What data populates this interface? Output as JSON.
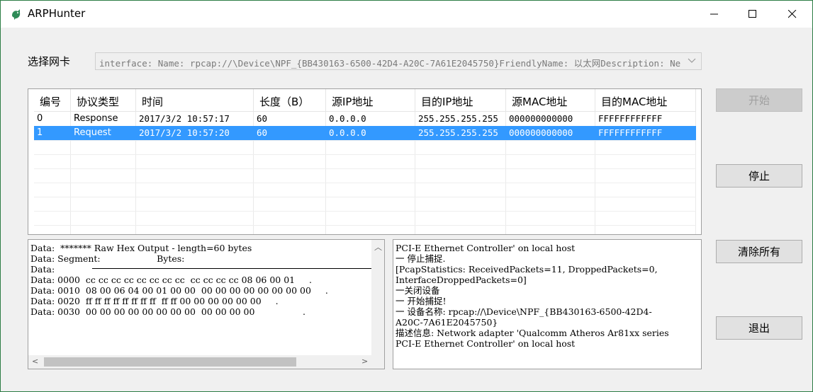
{
  "window": {
    "title": "ARPHunter"
  },
  "nic": {
    "label": "选择网卡",
    "value": "interface: Name: rpcap://\\Device\\NPF_{BB430163-6500-42D4-A20C-7A61E2045750}FriendlyName: 以太网Description: Ne"
  },
  "table": {
    "headers": [
      "编号",
      "协议类型",
      "时间",
      "长度（B）",
      "源IP地址",
      "目的IP地址",
      "源MAC地址",
      "目的MAC地址"
    ],
    "rows": [
      [
        "0",
        "Response",
        "2017/3/2 10:57:17",
        "60",
        "0.0.0.0",
        "255.255.255.255",
        "000000000000",
        "FFFFFFFFFFFF"
      ],
      [
        "1",
        "Request",
        "2017/3/2 10:57:20",
        "60",
        "0.0.0.0",
        "255.255.255.255",
        "000000000000",
        "FFFFFFFFFFFF"
      ]
    ]
  },
  "hex": {
    "lines": [
      "Data:  ******* Raw Hex Output - length=60 bytes",
      "Data: Segment:                    Bytes:",
      "Data:",
      "Data: 0000  cc cc cc cc cc cc cc cc  cc cc cc cc 08 06 00 01     .",
      "Data: 0010  08 00 06 04 00 01 00 00  00 00 00 00 00 00 00 00     .",
      "Data: 0020  ff ff ff ff ff ff ff ff  ff ff 00 00 00 00 00 00     .",
      "Data: 0030  00 00 00 00 00 00 00 00  00 00 00 00                 ."
    ]
  },
  "log": {
    "lines": [
      "PCI-E Ethernet Controller' on local host",
      "一 停止捕捉.",
      "[PcapStatistics: ReceivedPackets=11, DroppedPackets=0,",
      "InterfaceDroppedPackets=0]",
      "一关闭设备",
      "一 开始捕捉!",
      "一 设备名称: rpcap://\\Device\\NPF_{BB430163-6500-42D4-",
      "A20C-7A61E2045750}",
      "描述信息: Network adapter 'Qualcomm Atheros Ar81xx series",
      "PCI-E Ethernet Controller' on local host"
    ]
  },
  "buttons": {
    "start": "开始",
    "stop": "停止",
    "clear": "清除所有",
    "exit": "退出"
  },
  "colors": {
    "selection": "#3399ff",
    "window_border": "#2d7d45"
  }
}
